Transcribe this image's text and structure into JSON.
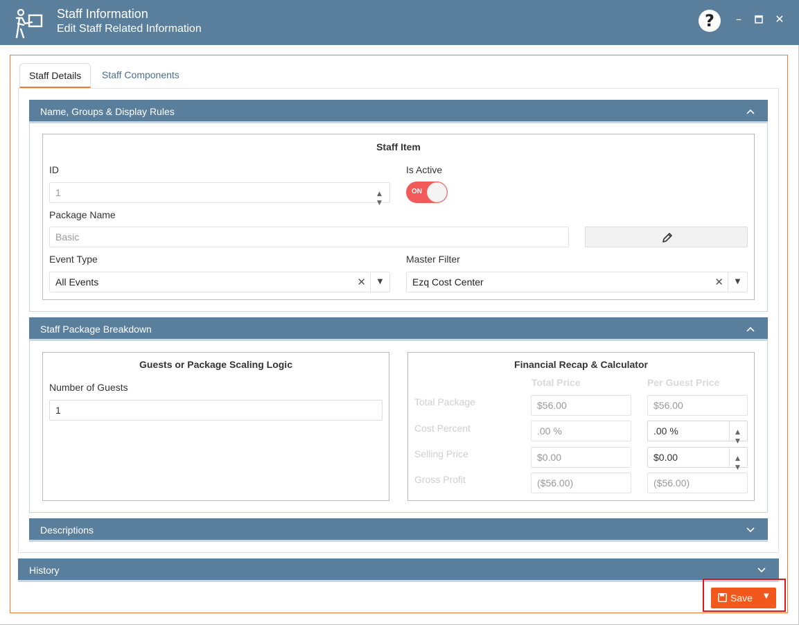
{
  "window": {
    "title": "Staff Information",
    "subtitle": "Edit Staff Related Information",
    "help_label": "?",
    "minimize_icon": "minimize-icon",
    "maximize_icon": "maximize-icon",
    "close_icon": "close-icon"
  },
  "tabs": [
    {
      "label": "Staff Details",
      "active": true
    },
    {
      "label": "Staff Components",
      "active": false
    }
  ],
  "sections": {
    "name_groups": {
      "title": "Name, Groups & Display Rules",
      "staff_item": {
        "title": "Staff Item",
        "id_label": "ID",
        "id_value": "1",
        "is_active_label": "Is Active",
        "toggle_text": "ON",
        "package_name_label": "Package Name",
        "package_name_value": "Basic",
        "event_type_label": "Event Type",
        "event_type_value": "All Events",
        "master_filter_label": "Master Filter",
        "master_filter_value": "Ezq Cost Center"
      }
    },
    "breakdown": {
      "title": "Staff Package Breakdown",
      "scaling": {
        "title": "Guests or Package Scaling Logic",
        "guests_label": "Number of Guests",
        "guests_value": "1"
      },
      "recap": {
        "title": "Financial Recap & Calculator",
        "col_total": "Total Price",
        "col_per_guest": "Per Guest Price",
        "rows": [
          {
            "label": "Total Package",
            "total": "$56.00",
            "per_guest": "$56.00"
          },
          {
            "label": "Cost Percent",
            "total": ".00 %",
            "per_guest": ".00 %"
          },
          {
            "label": "Selling Price",
            "total": "$0.00",
            "per_guest": "$0.00"
          },
          {
            "label": "Gross Profit",
            "total": "($56.00)",
            "per_guest": "($56.00)"
          }
        ]
      }
    },
    "descriptions": {
      "title": "Descriptions"
    },
    "history": {
      "title": "History"
    }
  },
  "actions": {
    "save_label": "Save"
  },
  "colors": {
    "header": "#5a7f9c",
    "accent": "#f07c34",
    "save": "#f2581c",
    "toggle_on": "#f25a5a"
  }
}
